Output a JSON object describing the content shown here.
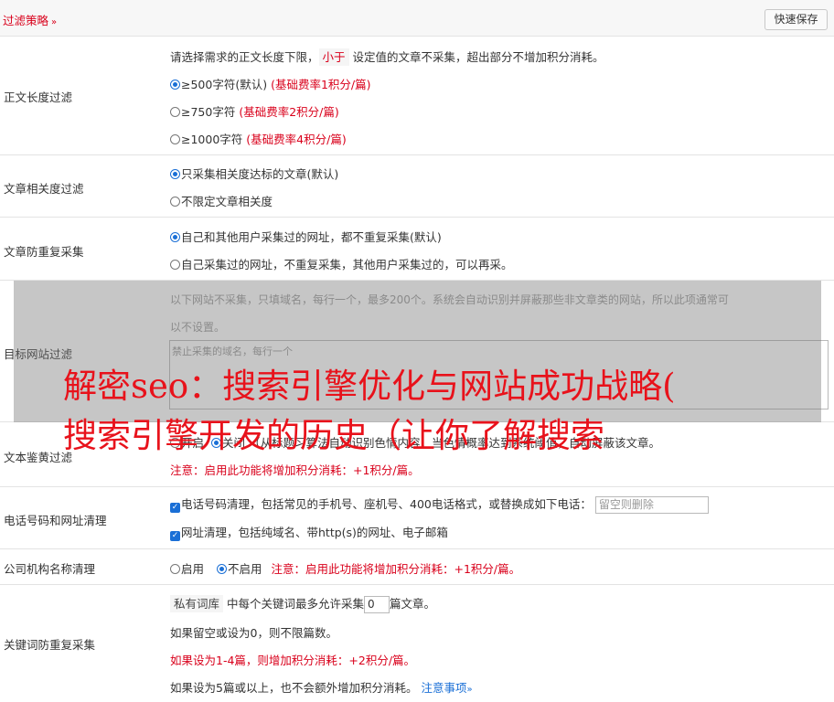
{
  "header": {
    "title": "过滤策略",
    "chevron": "»",
    "save_label": "快速保存"
  },
  "length_filter": {
    "label": "正文长度过滤",
    "desc_before": "请选择需求的正文长度下限，",
    "desc_highlight": "小于",
    "desc_after": "设定值的文章不采集，超出部分不增加积分消耗。",
    "options": [
      {
        "text": "≥500字符(默认)",
        "note": "(基础费率1积分/篇)",
        "selected": true
      },
      {
        "text": "≥750字符",
        "note": "(基础费率2积分/篇)",
        "selected": false
      },
      {
        "text": "≥1000字符",
        "note": "(基础费率4积分/篇)",
        "selected": false
      }
    ]
  },
  "relevance_filter": {
    "label": "文章相关度过滤",
    "options": [
      {
        "text": "只采集相关度达标的文章(默认)",
        "selected": true
      },
      {
        "text": "不限定文章相关度",
        "selected": false
      }
    ]
  },
  "duplicate_filter": {
    "label": "文章防重复采集",
    "options": [
      {
        "text": "自己和其他用户采集过的网址，都不重复采集(默认)",
        "selected": true
      },
      {
        "text": "自己采集过的网址，不重复采集，其他用户采集过的，可以再采。",
        "selected": false
      }
    ]
  },
  "site_filter": {
    "label": "目标网站过滤",
    "desc_line1": "以下网站不采集，只填域名，每行一个，最多200个。系统会自动识别并屏蔽那些非文章类的网站，所以此项通常可",
    "desc_line2": "以不设置。",
    "placeholder": "禁止采集的域名，每行一个"
  },
  "porn_filter": {
    "label": "文本鉴黄过滤",
    "opt_on": "开启",
    "opt_off": "关闭",
    "desc": "（从标题习算法自动识别色情内容，当色情概率达到系统阈值，自动屏蔽该文章。",
    "note": "注意：启用此功能将增加积分消耗：+1积分/篇。"
  },
  "phone_clean": {
    "label": "电话号码和网址清理",
    "phone_text": "电话号码清理，包括常见的手机号、座机号、400电话格式，或替换成如下电话：",
    "phone_placeholder": "留空则删除",
    "url_text": "网址清理，包括纯域名、带http(s)的网址、电子邮箱"
  },
  "company_clean": {
    "label": "公司机构名称清理",
    "opt_on": "启用",
    "opt_off": "不启用",
    "note": "注意：启用此功能将增加积分消耗：+1积分/篇。"
  },
  "keyword_dup": {
    "label": "关键词防重复采集",
    "tag": "私有词库",
    "line1_before": "中每个关键词最多允许采集",
    "value": "0",
    "line1_after": "篇文章。",
    "line2": "如果留空或设为0，则不限篇数。",
    "line3": "如果设为1-4篇，则增加积分消耗：+2积分/篇。",
    "line4": "如果设为5篇或以上，也不会额外增加积分消耗。",
    "link": "注意事项",
    "link_chevron": "»"
  },
  "banner": {
    "line1": "解密seo：搜索引擎优化与网站成功战略(",
    "line2": "搜索引擎开发的历史（让你了解搜索"
  }
}
